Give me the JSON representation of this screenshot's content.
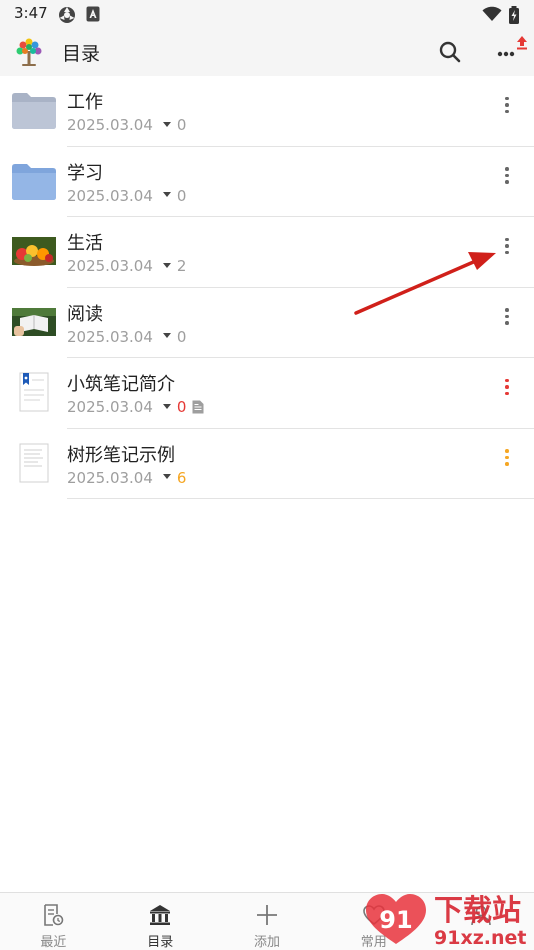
{
  "status_bar": {
    "time": "3:47"
  },
  "app_bar": {
    "title": "目录"
  },
  "items": [
    {
      "title": "工作",
      "date": "2025.03.04",
      "count": "0",
      "count_color": "#9e9e9e",
      "menu_color": "#666666",
      "thumb": "folder-gray-icon"
    },
    {
      "title": "学习",
      "date": "2025.03.04",
      "count": "0",
      "count_color": "#9e9e9e",
      "menu_color": "#666666",
      "thumb": "folder-blue-icon"
    },
    {
      "title": "生活",
      "date": "2025.03.04",
      "count": "2",
      "count_color": "#9e9e9e",
      "menu_color": "#666666",
      "thumb": "fruit-photo"
    },
    {
      "title": "阅读",
      "date": "2025.03.04",
      "count": "0",
      "count_color": "#9e9e9e",
      "menu_color": "#666666",
      "thumb": "reading-photo"
    },
    {
      "title": "小筑笔记简介",
      "date": "2025.03.04",
      "count": "0",
      "count_color": "#e53935",
      "menu_color": "#e53935",
      "thumb": "bookmark-document-icon"
    },
    {
      "title": "树形笔记示例",
      "date": "2025.03.04",
      "count": "6",
      "count_color": "#f5a623",
      "menu_color": "#f5a623",
      "thumb": "document-icon"
    }
  ],
  "bottom_nav": [
    {
      "label": "最近",
      "icon": "recent-notes-icon"
    },
    {
      "label": "目录",
      "icon": "catalog-bank-icon",
      "active": true
    },
    {
      "label": "添加",
      "icon": "plus-icon"
    },
    {
      "label": "常用",
      "icon": "heart-icon"
    },
    {
      "label": "",
      "icon": "profile-icon"
    }
  ],
  "watermark": {
    "main": "下载站",
    "sub": "91xz.net",
    "logo": "91"
  },
  "colors": {
    "background": "#ffffff",
    "bar": "#f5f5f5",
    "accent_red": "#e53935",
    "accent_orange": "#f5a623",
    "arrow": "#d0201a"
  }
}
